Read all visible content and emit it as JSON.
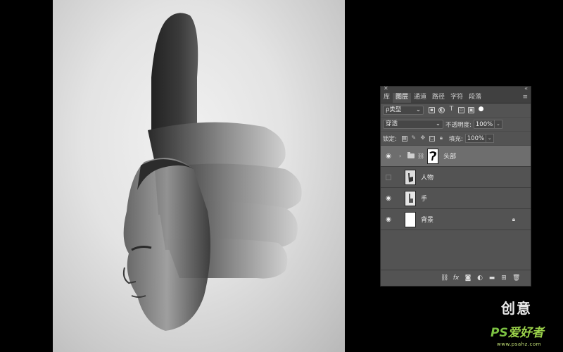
{
  "panel": {
    "tabs": [
      "库",
      "图层",
      "通道",
      "路径",
      "字符",
      "段落"
    ],
    "active_tab": "图层",
    "filter": {
      "label": "ρ类型"
    },
    "blend_mode": "穿透",
    "opacity": {
      "label": "不透明度:",
      "value": "100%"
    },
    "lock": {
      "label": "锁定:"
    },
    "fill": {
      "label": "填充:",
      "value": "100%"
    },
    "layers": [
      {
        "name": "头部",
        "type": "group",
        "visible": true,
        "selected": true
      },
      {
        "name": "人物",
        "type": "layer",
        "visible": false,
        "selected": false
      },
      {
        "name": "手",
        "type": "layer",
        "visible": true,
        "selected": false
      },
      {
        "name": "背景",
        "type": "background",
        "visible": true,
        "selected": false,
        "locked": true
      }
    ]
  },
  "watermark": {
    "line1": "创意",
    "line2_a": "PS",
    "line2_b": "爱好者",
    "url": "www.psahz.com"
  }
}
